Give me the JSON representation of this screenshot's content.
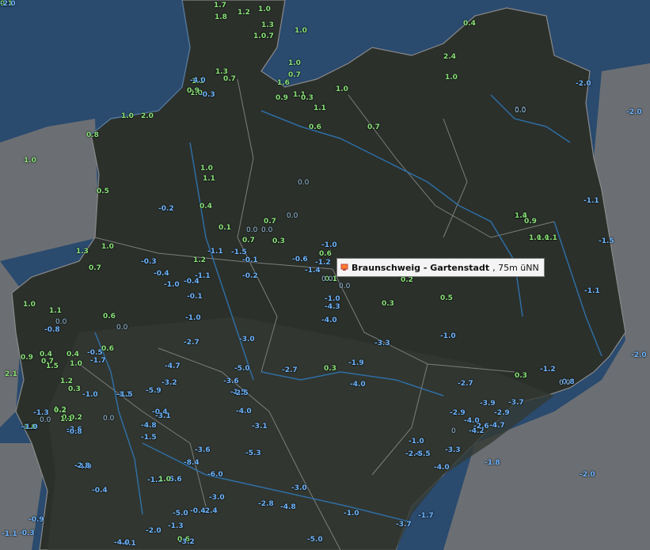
{
  "tooltip": {
    "station": "Braunschweig - Gartenstadt",
    "elevation": ", 75m üNN",
    "icon": "station-marker-icon"
  },
  "colors": {
    "sea": "#2a4a6e",
    "land": "#2b302b",
    "outside": "#6b6f73",
    "rivers": "#2f78b8",
    "borders": "#7a7a7a",
    "positive": "#8be37a",
    "negative": "#6fb6ff"
  },
  "values": [
    "1.7",
    "1.2",
    "1.0",
    "1.8",
    "1.3",
    "1.0",
    "1.0",
    "0.7",
    "0.4",
    "2.4",
    "1.0",
    "1.0",
    "0.7",
    "1.3",
    "0.7",
    "1.6",
    "1.1",
    "0.9",
    "1.0",
    "1.1",
    "0.3",
    "1.1",
    "1.0",
    "0.9",
    "0.6",
    "0.7",
    "1.0",
    "2.0",
    "0.8",
    "1.0",
    "1.0",
    "1.1",
    "0.5",
    "0.0",
    "-0.2",
    "0.4",
    "0.0",
    "0.7",
    "0.0",
    "0.1",
    "0.0",
    "0.7",
    "0.3",
    "0.0",
    "1.1",
    "-1.0",
    "1.3",
    "1.0",
    "-1.1",
    "-1.5",
    "-0.1",
    "-0.6",
    "0.6",
    "1.0",
    "-0.3",
    "-1.2",
    "0.7",
    "-0.4",
    "-1.0",
    "-1.1",
    "-0.2",
    "-1.4",
    "0.1",
    "-0.4",
    "0.0",
    "0.2",
    "-0.1",
    "1.0",
    "1.1",
    "0.6",
    "-1.0",
    "-4.3",
    "0.3",
    "0.0",
    "0.5",
    "-4.0",
    "0.0",
    "-0.8",
    "-1.0",
    "1.4",
    "0.9",
    "1.0",
    "1.1",
    "-1.1",
    "-1.5",
    "-2.0",
    "0.0",
    "-2.0",
    "-1.1",
    "-2.7",
    "-3.0",
    "-3.3",
    "-1.0",
    "0.6",
    "0.9",
    "0.4",
    "-0.5",
    "-1.7",
    "-5.0",
    "-2.7",
    "0.3",
    "-1.9",
    "0.7",
    "1.5",
    "1.0",
    "-4.7",
    "-3.6",
    "-1.5",
    "-1.2",
    "-2.0",
    "2.1",
    "1.2",
    "0.3",
    "-3.2",
    "-4.0",
    "-0.8",
    "0.4",
    "-1.0",
    "-1.1",
    "-5.9",
    "-2.5",
    "-2.7",
    "0.3",
    "1.2",
    "-1.3",
    "-0.4",
    "-4.0",
    "-3.9",
    "-3.7",
    "-4.9",
    "0.0",
    "0.9",
    "0.2",
    "0.0",
    "-4.8",
    "-3.1",
    "-2.9",
    "-2.9",
    "-2.6",
    "-1.5",
    "-3.1",
    "-4.0",
    "-4.7",
    "-4.2",
    "-2.6",
    "-3.6",
    "-5.3",
    "-1.0",
    "-3.3",
    "-2.4",
    "-5.5",
    "-8.4",
    "0",
    "-1.8",
    "-4.0",
    "-6.0",
    "-4.0",
    "-1.2",
    "-5.6",
    "-0.4",
    "-2.0",
    "-3.0",
    "-3.0",
    "-2.8",
    "-4.8",
    "-5.0",
    "-2.4",
    "-0.4",
    "-0.9",
    "-2.0",
    "-1.3",
    "0.6",
    "-0.3",
    "-1.0",
    "-1.7",
    "-3.7",
    "-5.0",
    "-4.1",
    "-4.0",
    "-3.2",
    "-2.8",
    "1.0",
    "-4.0",
    "-0.3",
    "1.1",
    "1.0",
    "0.2",
    "0.0",
    "1.2",
    "-0.8",
    "-1.0",
    "-1.5",
    "0.0",
    "-1.1",
    "0.1",
    "-2.0"
  ]
}
